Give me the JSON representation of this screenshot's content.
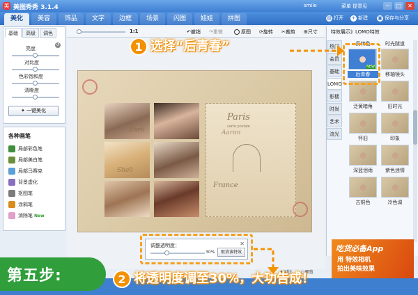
{
  "titlebar": {
    "logo_char": "美",
    "title": "美图秀秀 3.1.4",
    "username": "smile",
    "links": "菜单  提意见",
    "min": "─",
    "max": "□",
    "close": "✕"
  },
  "nav": {
    "tabs": [
      "美化",
      "美容",
      "饰品",
      "文字",
      "边框",
      "场景",
      "闪图",
      "娃娃",
      "拼图"
    ],
    "active": 0
  },
  "right_actions": {
    "open": "打开",
    "new": "新建",
    "save_share": "保存与分享"
  },
  "left_panel": {
    "tabs": [
      "基础",
      "高级",
      "调色"
    ],
    "sliders": [
      {
        "label": "亮度",
        "value": 0.5
      },
      {
        "label": "对比度",
        "value": 0.5
      },
      {
        "label": "色彩饱和度",
        "value": 0.5
      },
      {
        "label": "清晰度",
        "value": 0.5
      }
    ],
    "one_click": "一键美化"
  },
  "brushes": {
    "title": "各种画笔",
    "items": [
      {
        "label": "局部彩色笔",
        "color": "#3f8f3f",
        "new": ""
      },
      {
        "label": "局部美白笔",
        "color": "#6b8f3a",
        "new": ""
      },
      {
        "label": "局部马赛克",
        "color": "#5aa0d8",
        "new": ""
      },
      {
        "label": "背景虚化",
        "color": "#8a6fc0",
        "new": ""
      },
      {
        "label": "抠图笔",
        "color": "#7c7c7c",
        "new": ""
      },
      {
        "label": "涂鸦笔",
        "color": "#d98c1e",
        "new": ""
      },
      {
        "label": "消除笔",
        "color": "#e0a0c8",
        "new": "New"
      }
    ]
  },
  "toolbar": {
    "zoom": "1:1",
    "undo": "撤销",
    "redo": "重做",
    "original": "原图",
    "rotate": "旋转",
    "crop": "裁剪",
    "size": "尺寸"
  },
  "canvas": {
    "stamp_title": "Paris",
    "stamp_sub": "carte postale",
    "stamp_bottom": "France",
    "overlay_1": "Sheli",
    "overlay_2": "Aaron",
    "overlay_3": "Sheli"
  },
  "opacity_dialog": {
    "label": "调整透明度：",
    "value_text": "30%",
    "value": 0.3,
    "cancel": "取消该特效",
    "close": "✕"
  },
  "right_panel": {
    "title": "特效展示》LOMO特效",
    "categories": [
      "热门",
      "会员",
      "基础",
      "LOMO",
      "影楼",
      "时尚",
      "艺术",
      "流光"
    ],
    "active_category": 3,
    "thumbs": [
      {
        "label": "反转色",
        "new": ""
      },
      {
        "label": "时光隧道",
        "new": ""
      },
      {
        "label": "后青春",
        "new": "NEW"
      },
      {
        "label": "移轴镜头",
        "new": ""
      },
      {
        "label": "泛黄暗角",
        "new": ""
      },
      {
        "label": "旧时光",
        "new": ""
      },
      {
        "label": "怀旧",
        "new": ""
      },
      {
        "label": "印象",
        "new": ""
      },
      {
        "label": "深蓝泪雨",
        "new": ""
      },
      {
        "label": "紫色迷情",
        "new": ""
      },
      {
        "label": "古铜色",
        "new": ""
      },
      {
        "label": "冷色调",
        "new": ""
      }
    ],
    "selected": 2
  },
  "ad": {
    "line1": "吃货必备App",
    "line2": "用 特效相机",
    "line3": "拍出美味效果"
  },
  "bottom": {
    "compare": "对比",
    "preview": "预览"
  },
  "step_banner": "第五步:",
  "callout_1": {
    "num": "1",
    "text": "选择“后青春”"
  },
  "callout_2": {
    "num": "2",
    "text": "将透明度调至30%，大功告成！"
  },
  "colors": {
    "accent": "#f39200",
    "nav": "#3f7fd4",
    "step_green": "#2f9e3b"
  }
}
